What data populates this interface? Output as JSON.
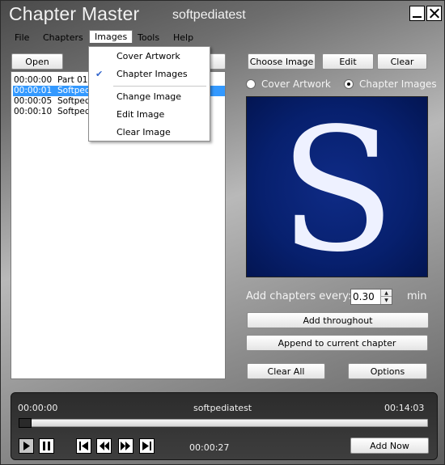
{
  "window": {
    "title": "Chapter Master",
    "user": "softpediatest"
  },
  "menu": {
    "items": [
      "File",
      "Chapters",
      "Images",
      "Tools",
      "Help"
    ]
  },
  "left_panel": {
    "open_label": "Open",
    "chapters": [
      {
        "time": "00:00:00",
        "name": "Part 01"
      },
      {
        "time": "00:00:01",
        "name": "Softped"
      },
      {
        "time": "00:00:05",
        "name": "Softped"
      },
      {
        "time": "00:00:10",
        "name": "Softped"
      }
    ],
    "selected_index": 1
  },
  "images_menu": {
    "cover_artwork": "Cover Artwork",
    "chapter_images": "Chapter Images",
    "change_image": "Change Image",
    "edit_image": "Edit Image",
    "clear_image": "Clear Image",
    "checked": "chapter_images"
  },
  "image_panel": {
    "choose_label": "Choose Image",
    "edit_label": "Edit",
    "clear_label": "Clear",
    "radio_cover": "Cover Artwork",
    "radio_chapter": "Chapter Images",
    "selected_radio": "chapter",
    "preview_letter": "S"
  },
  "chapters_panel": {
    "add_every_label": "Add chapters every:",
    "interval_value": "0.30",
    "unit": "min",
    "add_throughout": "Add throughout",
    "append_current": "Append to current chapter",
    "clear_all": "Clear All",
    "options": "Options"
  },
  "player": {
    "start_time": "00:00:00",
    "title": "softpediatest",
    "end_time": "00:14:03",
    "current_time": "00:00:27",
    "add_now": "Add Now",
    "progress": 0.032
  },
  "colors": {
    "selection": "#3399ff",
    "preview_bg": "#07206e",
    "player_bg": "#333333"
  }
}
